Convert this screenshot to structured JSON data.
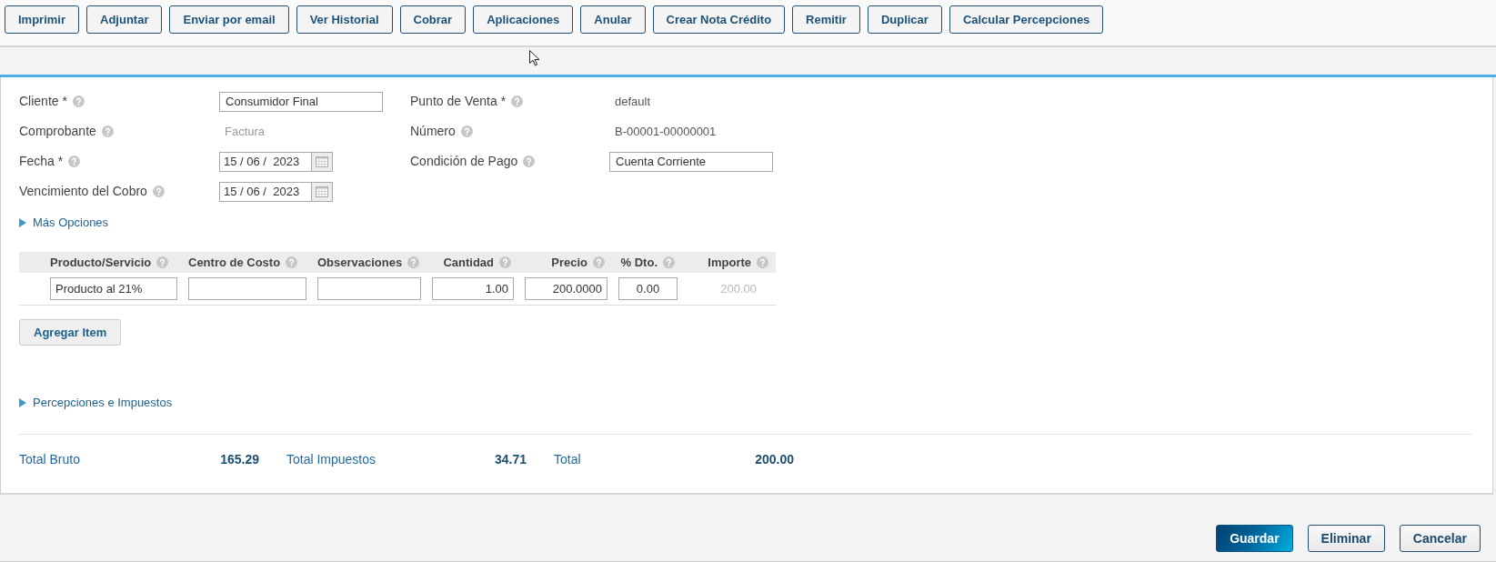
{
  "toolbar": {
    "buttons": [
      "Imprimir",
      "Adjuntar",
      "Enviar por email",
      "Ver Historial",
      "Cobrar",
      "Aplicaciones",
      "Anular",
      "Crear Nota Crédito",
      "Remitir",
      "Duplicar",
      "Calcular Percepciones"
    ]
  },
  "form": {
    "rows": [
      [
        {
          "label": "Cliente *",
          "help": true,
          "kind": "input",
          "value": "Consumidor Final",
          "disabled": false
        },
        {
          "label": "Punto de Venta *",
          "help": true,
          "kind": "static",
          "value": "default",
          "disabled": false
        }
      ],
      [
        {
          "label": "Comprobante",
          "help": true,
          "kind": "static",
          "value": "Factura",
          "disabled": true
        },
        {
          "label": "Número",
          "help": true,
          "kind": "static",
          "value": "B-00001-00000001",
          "disabled": false
        }
      ],
      [
        {
          "label": "Fecha *",
          "help": true,
          "kind": "date",
          "value": "15 / 06 /  2023",
          "disabled": false
        },
        {
          "label": "Condición de Pago",
          "help": true,
          "kind": "input",
          "value": "Cuenta Corriente",
          "disabled": false
        }
      ],
      [
        {
          "label": "Vencimiento del Cobro",
          "help": true,
          "kind": "date",
          "value": "15 / 06 /  2023",
          "disabled": false
        }
      ]
    ]
  },
  "more_options": {
    "label": "Más Opciones",
    "expanded": false
  },
  "items_table": {
    "columns": [
      {
        "label": "Producto/Servicio",
        "help": true,
        "kind": "text"
      },
      {
        "label": "Centro de Costo",
        "help": true,
        "kind": "text"
      },
      {
        "label": "Observaciones",
        "help": true,
        "kind": "text"
      },
      {
        "label": "Cantidad",
        "help": true,
        "kind": "number"
      },
      {
        "label": "Precio",
        "help": true,
        "kind": "number"
      },
      {
        "label": "% Dto.",
        "help": true,
        "kind": "percent"
      },
      {
        "label": "Importe",
        "help": true,
        "kind": "amount"
      }
    ],
    "rows": [
      {
        "cells": [
          {
            "kind": "input",
            "value": "Producto al 21%"
          },
          {
            "kind": "input"
          },
          {
            "kind": "input"
          },
          {
            "kind": "input",
            "value": "1.00"
          },
          {
            "kind": "input",
            "value": "200.0000"
          },
          {
            "kind": "input",
            "value": "0.00"
          },
          {
            "kind": "text",
            "value": "200.00"
          }
        ]
      }
    ]
  },
  "add_item_button": "Agregar Item",
  "taxes_section": {
    "label": "Percepciones e Impuestos",
    "expanded": false
  },
  "totals": [
    {
      "label": "Total Bruto",
      "value": "165.29"
    },
    {
      "label": "Total Impuestos",
      "value": "34.71"
    },
    {
      "label": "Total",
      "value": "200.00"
    }
  ],
  "footer_buttons": [
    {
      "label": "Guardar",
      "kind": "primary"
    },
    {
      "label": "Eliminar",
      "kind": "default"
    },
    {
      "label": "Cancelar",
      "kind": "default"
    }
  ]
}
